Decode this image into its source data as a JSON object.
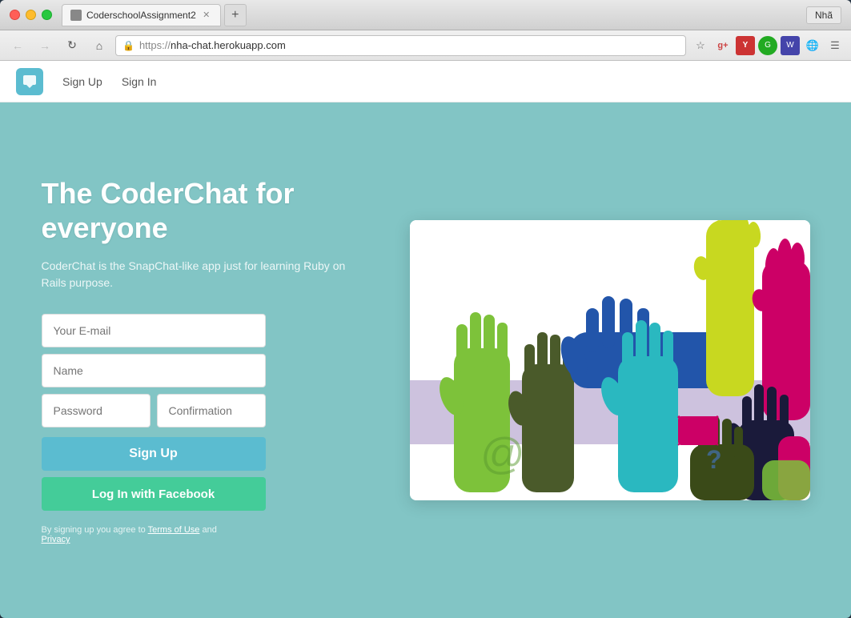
{
  "browser": {
    "tab_label": "CoderschoolAssignment2",
    "profile_label": "Nhã",
    "url": "https://nha-chat.herokuapp.com"
  },
  "app_nav": {
    "sign_up_label": "Sign Up",
    "sign_in_label": "Sign In"
  },
  "hero": {
    "title": "The CoderChat for everyone",
    "subtitle": "CoderChat is the SnapChat-like app just for learning Ruby on Rails purpose."
  },
  "form": {
    "email_placeholder": "Your E-mail",
    "name_placeholder": "Name",
    "password_placeholder": "Password",
    "confirmation_placeholder": "Confirmation",
    "signup_label": "Sign Up",
    "facebook_label": "Log In with Facebook",
    "terms_text": "By signing up you agree to ",
    "terms_of_use": "Terms of Use",
    "and_text": " and",
    "privacy": "Privacy"
  }
}
